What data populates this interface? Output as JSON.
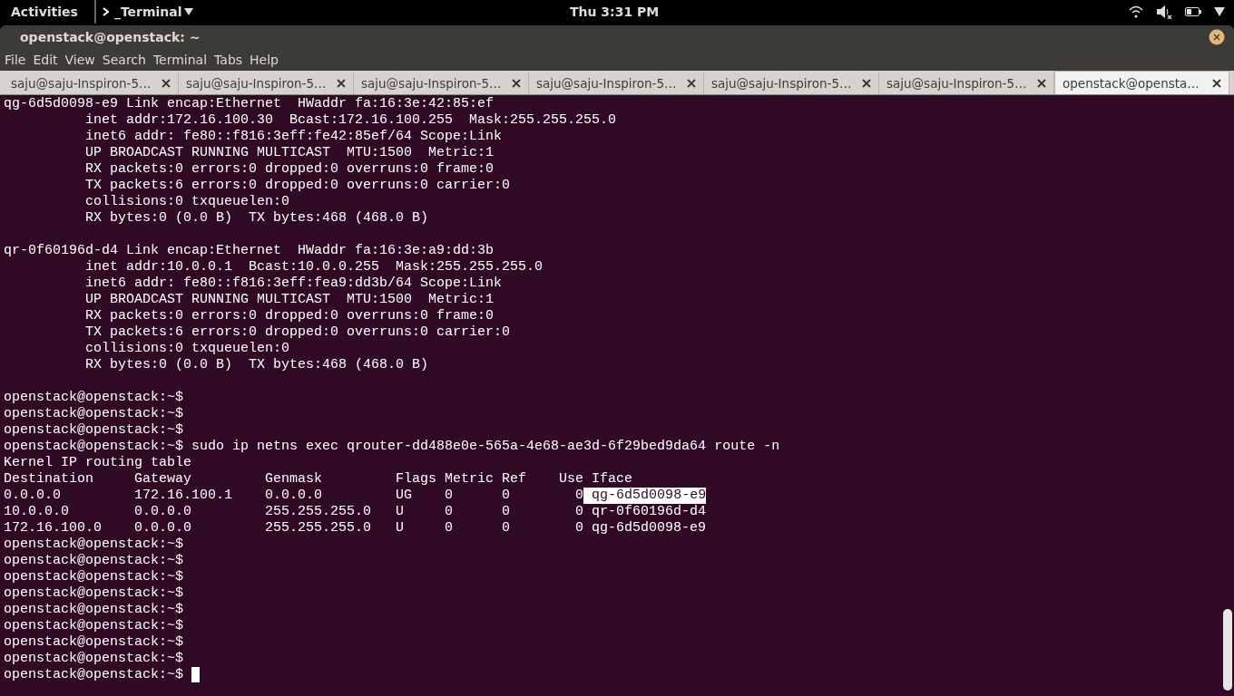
{
  "top_bar": {
    "activities": "Activities",
    "app_menu": "_Terminal",
    "clock": "Thu  3:31 PM"
  },
  "window": {
    "title": "openstack@openstack: ~"
  },
  "menu": [
    "File",
    "Edit",
    "View",
    "Search",
    "Terminal",
    "Tabs",
    "Help"
  ],
  "tabs": [
    {
      "label": "saju@saju-Inspiron-5…",
      "selected": false
    },
    {
      "label": "saju@saju-Inspiron-5…",
      "selected": false
    },
    {
      "label": "saju@saju-Inspiron-5…",
      "selected": false
    },
    {
      "label": "saju@saju-Inspiron-5…",
      "selected": false
    },
    {
      "label": "saju@saju-Inspiron-5…",
      "selected": false
    },
    {
      "label": "saju@saju-Inspiron-5…",
      "selected": false
    },
    {
      "label": "openstack@opensta…",
      "selected": true
    }
  ],
  "terminal": {
    "lines": [
      {
        "text": "qg-6d5d0098-e9 Link encap:Ethernet  HWaddr fa:16:3e:42:85:ef"
      },
      {
        "text": "          inet addr:172.16.100.30  Bcast:172.16.100.255  Mask:255.255.255.0"
      },
      {
        "text": "          inet6 addr: fe80::f816:3eff:fe42:85ef/64 Scope:Link"
      },
      {
        "text": "          UP BROADCAST RUNNING MULTICAST  MTU:1500  Metric:1"
      },
      {
        "text": "          RX packets:0 errors:0 dropped:0 overruns:0 frame:0"
      },
      {
        "text": "          TX packets:6 errors:0 dropped:0 overruns:0 carrier:0"
      },
      {
        "text": "          collisions:0 txqueuelen:0"
      },
      {
        "text": "          RX bytes:0 (0.0 B)  TX bytes:468 (468.0 B)",
        "blank_after": true
      },
      {
        "text": "qr-0f60196d-d4 Link encap:Ethernet  HWaddr fa:16:3e:a9:dd:3b"
      },
      {
        "text": "          inet addr:10.0.0.1  Bcast:10.0.0.255  Mask:255.255.255.0"
      },
      {
        "text": "          inet6 addr: fe80::f816:3eff:fea9:dd3b/64 Scope:Link"
      },
      {
        "text": "          UP BROADCAST RUNNING MULTICAST  MTU:1500  Metric:1"
      },
      {
        "text": "          RX packets:0 errors:0 dropped:0 overruns:0 frame:0"
      },
      {
        "text": "          TX packets:6 errors:0 dropped:0 overruns:0 carrier:0"
      },
      {
        "text": "          collisions:0 txqueuelen:0"
      },
      {
        "text": "          RX bytes:0 (0.0 B)  TX bytes:468 (468.0 B)",
        "blank_after": true
      },
      {
        "text": "openstack@openstack:~$"
      },
      {
        "text": "openstack@openstack:~$"
      },
      {
        "text": "openstack@openstack:~$"
      },
      {
        "text": "openstack@openstack:~$ sudo ip netns exec qrouter-dd488e0e-565a-4e68-ae3d-6f29bed9da64 route -n"
      },
      {
        "text": "Kernel IP routing table"
      },
      {
        "text": "Destination     Gateway         Genmask         Flags Metric Ref    Use Iface"
      },
      {
        "text": "0.0.0.0         172.16.100.1    0.0.0.0         UG    0      0        0",
        "selection": " qg-6d5d0098-e9"
      },
      {
        "text": "10.0.0.0        0.0.0.0         255.255.255.0   U     0      0        0 qr-0f60196d-d4"
      },
      {
        "text": "172.16.100.0    0.0.0.0         255.255.255.0   U     0      0        0 qg-6d5d0098-e9"
      },
      {
        "text": "openstack@openstack:~$"
      },
      {
        "text": "openstack@openstack:~$"
      },
      {
        "text": "openstack@openstack:~$"
      },
      {
        "text": "openstack@openstack:~$"
      },
      {
        "text": "openstack@openstack:~$"
      },
      {
        "text": "openstack@openstack:~$"
      },
      {
        "text": "openstack@openstack:~$"
      },
      {
        "text": "openstack@openstack:~$"
      },
      {
        "text": "openstack@openstack:~$ ",
        "cursor": true
      }
    ]
  }
}
